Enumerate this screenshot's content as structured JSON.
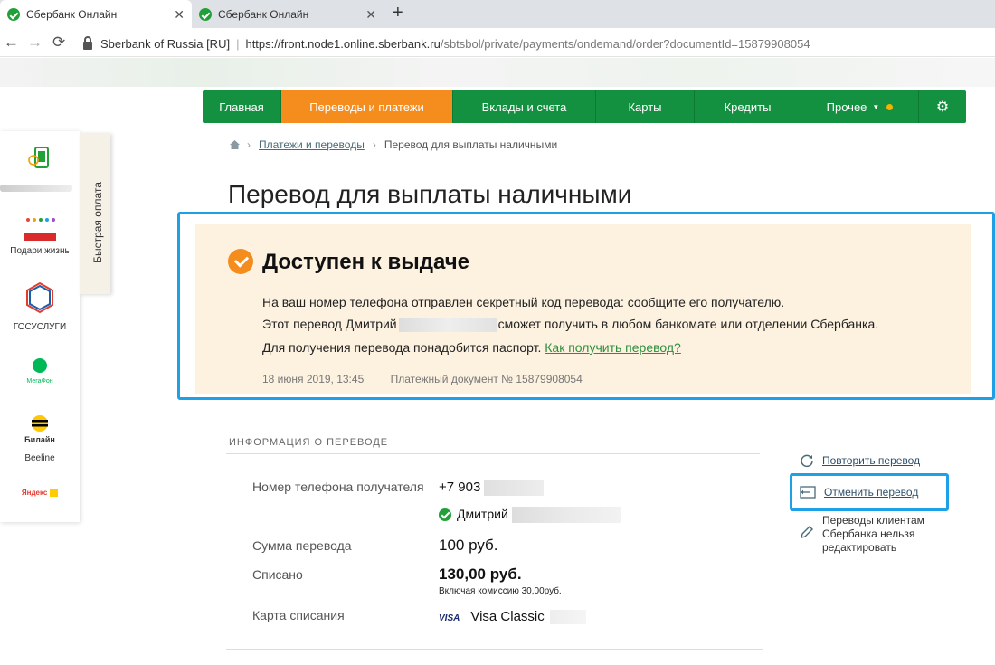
{
  "browser": {
    "tabs": [
      {
        "title": "Сбербанк Онлайн",
        "active": true
      },
      {
        "title": "Сбербанк Онлайн",
        "active": false
      }
    ],
    "new_tab": "+",
    "close": "✕",
    "back": "←",
    "forward": "→",
    "reload": "⟳",
    "site_identity": "Sberbank of Russia [RU]",
    "url_host": "https://front.node1.online.sberbank.ru",
    "url_path": "/sbtsbol/private/payments/ondemand/order?documentId=15879908054"
  },
  "nav": {
    "items": [
      {
        "label": "Главная",
        "active": false
      },
      {
        "label": "Переводы и платежи",
        "active": true
      },
      {
        "label": "Вклады и счета",
        "active": false
      },
      {
        "label": "Карты",
        "active": false
      },
      {
        "label": "Кредиты",
        "active": false
      },
      {
        "label": "Прочее",
        "active": false
      }
    ],
    "settings_glyph": "⚙",
    "caret_glyph": "▼"
  },
  "quick_pay": {
    "tab_label": "Быстрая оплата",
    "items": [
      {
        "label": "Подари жизнь"
      },
      {
        "label": "ГОСУСЛУГИ"
      },
      {
        "label": "Beeline"
      }
    ],
    "gos_logo_text": "гос\nуслуги",
    "megafon_text": "МегаФон",
    "beeline_logo_text": "Билайн",
    "yandex_text": "Яндекс"
  },
  "breadcrumb": {
    "items": [
      "Платежи и переводы",
      "Перевод для выплаты наличными"
    ],
    "sep": "›"
  },
  "page": {
    "title": "Перевод для выплаты наличными"
  },
  "status": {
    "title": "Доступен к выдаче",
    "line1": "На ваш номер телефона отправлен секретный код перевода: сообщите его получателю.",
    "line2_prefix": "Этот перевод Дмитрий",
    "line2_suffix": "сможет получить в любом банкомате или отделении Сбербанка.",
    "line3_prefix": "Для получения перевода понадобится паспорт.",
    "line3_link": "Как получить перевод?",
    "date": "18 июня 2019, 13:45",
    "document": "Платежный документ № 15879908054"
  },
  "info": {
    "section_title": "ИНФОРМАЦИЯ О ПЕРЕВОДЕ",
    "phone_label": "Номер телефона получателя",
    "phone_value": "+7 903",
    "recipient_name": "Дмитрий",
    "amount_label": "Сумма перевода",
    "amount_value": "100  руб.",
    "debited_label": "Списано",
    "debited_value": "130,00 руб.",
    "commission": "Включая комиссию 30,00руб.",
    "card_label": "Карта списания",
    "card_brand": "VISA",
    "card_name": "Visa Classic"
  },
  "actions": {
    "repeat": "Повторить перевод",
    "cancel": "Отменить перевод",
    "edit_note": "Переводы клиентам Сбербанка нельзя редактировать"
  },
  "colors": {
    "sber_green": "#139040",
    "active_orange": "#f58c1e",
    "highlight_blue": "#1ea0e6",
    "status_bg": "#fdf2e0"
  }
}
